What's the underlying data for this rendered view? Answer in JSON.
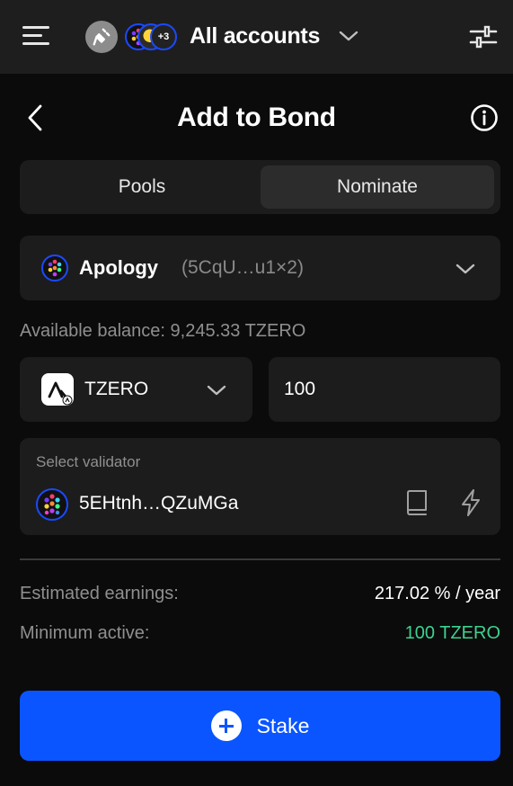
{
  "topbar": {
    "account_title": "All accounts",
    "extra_accounts_badge": "+3",
    "icons": [
      "menu-icon",
      "plug-icon",
      "chevron-down-icon",
      "sliders-icon"
    ]
  },
  "header": {
    "title": "Add to Bond",
    "icons": [
      "back-arrow-icon",
      "info-icon"
    ]
  },
  "tabs": [
    {
      "label": "Pools",
      "active": false
    },
    {
      "label": "Nominate",
      "active": true
    }
  ],
  "pool": {
    "name": "Apology",
    "address": "(5CqU…u1×2)"
  },
  "balance": {
    "text": "Available balance: 9,245.33 TZERO"
  },
  "token": {
    "symbol": "TZERO",
    "amount": "100"
  },
  "validator": {
    "label": "Select validator",
    "address": "5EHtnh…QZuMGa",
    "icons": [
      "book-icon",
      "lightning-icon"
    ]
  },
  "summary": {
    "earnings_label": "Estimated earnings:",
    "earnings_value": "217.02 % / year",
    "min_label": "Minimum active:",
    "min_value": "100 TZERO"
  },
  "action": {
    "stake_label": "Stake"
  },
  "colors": {
    "background": "#0b0b0b",
    "surface": "#1c1c1c",
    "primary": "#0a55ff",
    "success": "#3fd18f",
    "muted": "#8f8f8f"
  }
}
